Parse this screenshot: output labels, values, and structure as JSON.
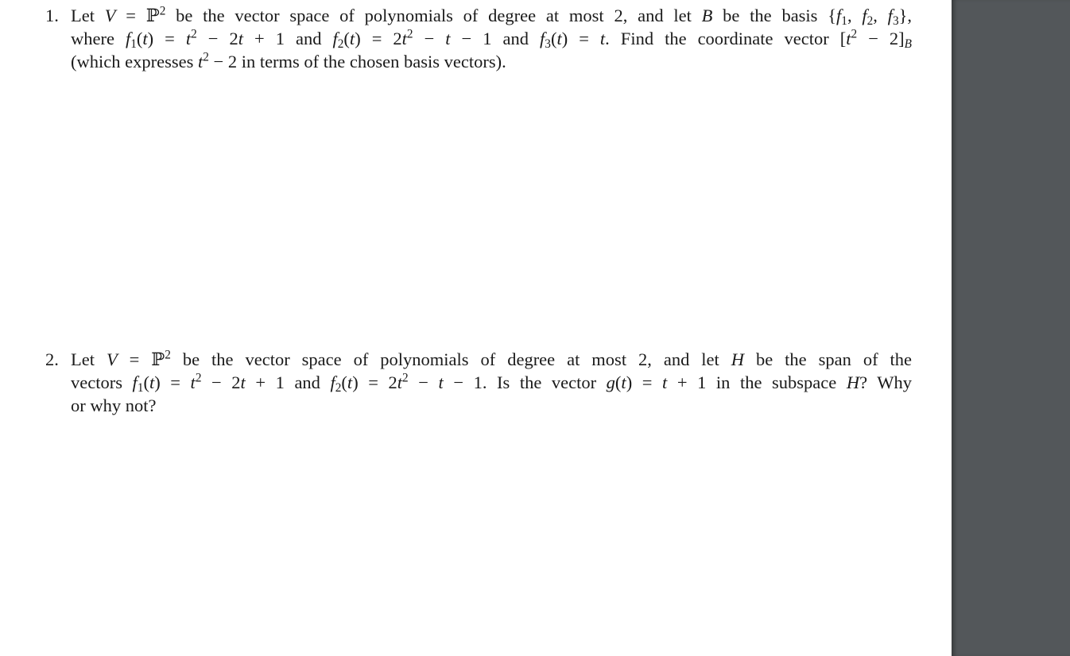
{
  "document": {
    "problems": [
      {
        "number": "1.",
        "lines": [
          "Let V = ℙ² be the vector space of polynomials of degree at most 2, and let B be the basis {f₁, f₂, f₃},",
          "where f₁(t) = t² − 2t + 1 and f₂(t) = 2t² − t − 1 and f₃(t) = t. Find the coordinate vector [t² − 2]_B",
          "(which expresses t² − 2 in terms of the chosen basis vectors)."
        ],
        "segments": {
          "l1_a": "Let ",
          "l1_V": "V",
          "l1_b": " = ℙ",
          "l1_sup": "2",
          "l1_c": " be the vector space of polynomials of degree at most 2, and let ",
          "l1_B": "B",
          "l1_d": " be the basis {",
          "l1_f1": "f",
          "l1_s1": "1",
          "l1_e": ", ",
          "l1_f2": "f",
          "l1_s2": "2",
          "l1_f": ", ",
          "l1_f3": "f",
          "l1_s3": "3",
          "l1_g": "},",
          "l2_a": "where ",
          "l2_f1": "f",
          "l2_s1": "1",
          "l2_b": "(",
          "l2_t1": "t",
          "l2_c": ") = ",
          "l2_t2": "t",
          "l2_sup1": "2",
          "l2_d": " − 2",
          "l2_t3": "t",
          "l2_e": " + 1 and ",
          "l2_f2": "f",
          "l2_s2": "2",
          "l2_g": "(",
          "l2_t4": "t",
          "l2_h": ") = 2",
          "l2_t5": "t",
          "l2_sup2": "2",
          "l2_i": " − ",
          "l2_t6": "t",
          "l2_j": " − 1 and ",
          "l2_f3": "f",
          "l2_s3": "3",
          "l2_k": "(",
          "l2_t7": "t",
          "l2_l": ") = ",
          "l2_t8": "t",
          "l2_m": ". Find the coordinate vector [",
          "l2_t9": "t",
          "l2_sup3": "2",
          "l2_n": " − 2]",
          "l2_subB": "B",
          "l3_a": "(which expresses ",
          "l3_t": "t",
          "l3_sup": "2",
          "l3_b": " − 2 in terms of the chosen basis vectors)."
        }
      },
      {
        "number": "2.",
        "lines": [
          "Let V = ℙ² be the vector space of polynomials of degree at most 2, and let H be the span of the",
          "vectors f₁(t) = t² − 2t + 1 and f₂(t) = 2t² − t − 1. Is the vector g(t) = t + 1 in the subspace H? Why",
          "or why not?"
        ],
        "segments": {
          "l1_a": "Let ",
          "l1_V": "V",
          "l1_b": " = ℙ",
          "l1_sup": "2",
          "l1_c": " be the vector space of polynomials of degree at most 2, and let ",
          "l1_H": "H",
          "l1_d": " be the span of the",
          "l2_a": "vectors ",
          "l2_f1": "f",
          "l2_s1": "1",
          "l2_b": "(",
          "l2_t1": "t",
          "l2_c": ") = ",
          "l2_t2": "t",
          "l2_sup1": "2",
          "l2_d": " − 2",
          "l2_t3": "t",
          "l2_e": " + 1 and ",
          "l2_f2": "f",
          "l2_s2": "2",
          "l2_g": "(",
          "l2_t4": "t",
          "l2_h": ") = 2",
          "l2_t5": "t",
          "l2_sup2": "2",
          "l2_i": " − ",
          "l2_t6": "t",
          "l2_j": " − 1. Is the vector ",
          "l2_gf": "g",
          "l2_k": "(",
          "l2_t7": "t",
          "l2_l": ") = ",
          "l2_t8": "t",
          "l2_m": " + 1 in the subspace ",
          "l2_H": "H",
          "l2_n": "? Why",
          "l3_a": "or why not?"
        }
      }
    ]
  },
  "colors": {
    "page": "#ffffff",
    "viewer_background": "#53575a",
    "text": "#1a1a1a"
  }
}
